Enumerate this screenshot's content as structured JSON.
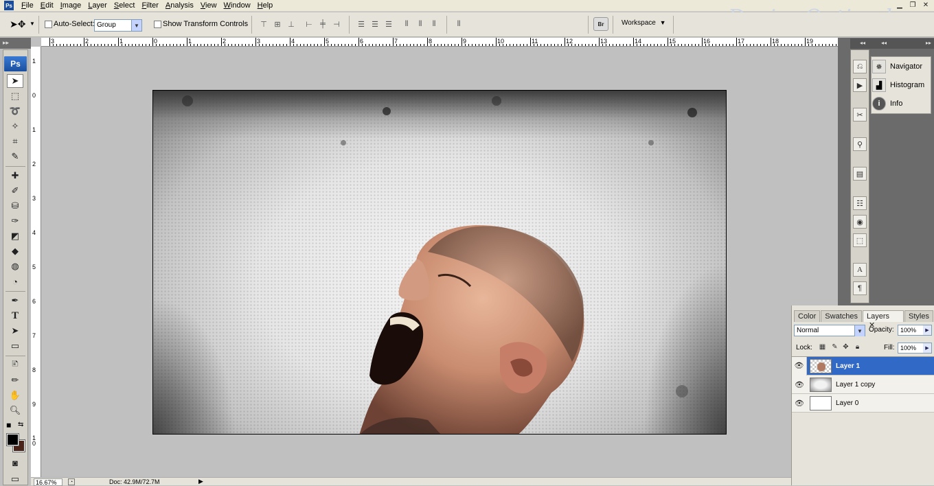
{
  "menu": [
    "File",
    "Edit",
    "Image",
    "Layer",
    "Select",
    "Filter",
    "Analysis",
    "View",
    "Window",
    "Help"
  ],
  "app_badge": "Ps",
  "watermark": "DesignOptimal.com",
  "options": {
    "auto_select_label": "Auto-Select:",
    "auto_select_value": "Group",
    "transform_label": "Show Transform Controls",
    "workspace_label": "Workspace",
    "bridge_label": "Br"
  },
  "ruler_top": [
    "3",
    "2",
    "1",
    "0",
    "1",
    "2",
    "3",
    "4",
    "5",
    "6",
    "7",
    "8",
    "9",
    "10",
    "11",
    "12",
    "13",
    "14",
    "15",
    "16",
    "17",
    "18",
    "19"
  ],
  "ruler_left": [
    "1",
    "0",
    "1",
    "2",
    "3",
    "4",
    "5",
    "6",
    "7",
    "8",
    "9",
    "1\n0"
  ],
  "status": {
    "zoom": "16.67%",
    "doc": "Doc: 42.9M/72.7M"
  },
  "right_panels": {
    "items": [
      "Navigator",
      "Histogram",
      "Info"
    ]
  },
  "layers_panel": {
    "tabs": [
      "Color",
      "Swatches",
      "Layers",
      "Styles"
    ],
    "active_tab": "Layers",
    "blend_mode": "Normal",
    "opacity_label": "Opacity:",
    "opacity": "100%",
    "lock_label": "Lock:",
    "fill_label": "Fill:",
    "fill": "100%",
    "layers": [
      {
        "name": "Layer 1",
        "selected": true
      },
      {
        "name": "Layer 1 copy",
        "selected": false
      },
      {
        "name": "Layer 0",
        "selected": false
      }
    ]
  },
  "colors": {
    "foreground": "#000000",
    "background": "#4a2418",
    "selection": "#3169c6"
  }
}
